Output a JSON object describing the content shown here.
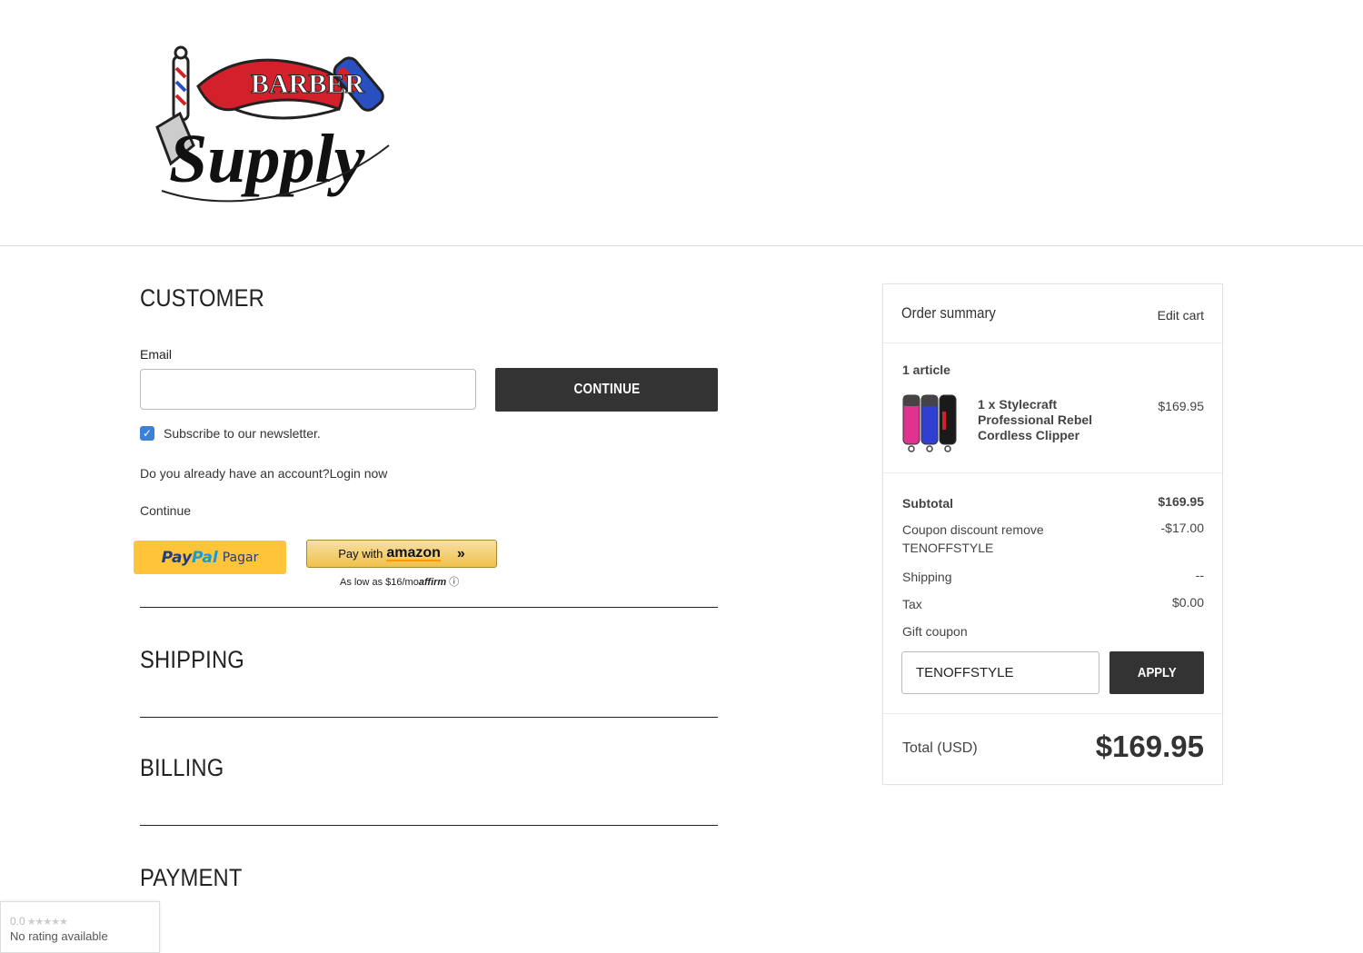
{
  "header": {
    "logo": {
      "top_text": "BARBER",
      "main_text": "Supply"
    }
  },
  "customer": {
    "title": "CUSTOMER",
    "email_label": "Email",
    "email_value": "",
    "continue_button": "CONTINUE",
    "newsletter_label": "Subscribe to our newsletter.",
    "newsletter_checked": true,
    "account_question": "Do you already have an account?Login now",
    "continue_link": "Continue"
  },
  "paypal": {
    "pay": "Pay",
    "pal": "Pal",
    "label": "Pagar",
    "color": "#ffc439"
  },
  "amazon": {
    "prefix": "Pay with",
    "brand": "amazon",
    "arrows": "»"
  },
  "affirm": {
    "text": "As low as $16/mo",
    "brand": "affirm",
    "info": "ⓘ"
  },
  "sections": {
    "shipping": "SHIPPING",
    "billing": "BILLING",
    "payment": "PAYMENT"
  },
  "order_summary": {
    "title": "Order summary",
    "edit_cart": "Edit cart",
    "article_count": "1 article",
    "item": {
      "name": "1 x Stylecraft Professional Rebel Cordless Clipper",
      "price": "$169.95",
      "colors": [
        "#e0338f",
        "#2f3fd1",
        "#1a1a1a"
      ]
    },
    "subtotal_label": "Subtotal",
    "subtotal_value": "$169.95",
    "coupon_label": "Coupon discount remove TENOFFSTYLE",
    "coupon_value": "-$17.00",
    "shipping_label": "Shipping",
    "shipping_value": "--",
    "tax_label": "Tax",
    "tax_value": "$0.00",
    "gift_label": "Gift coupon",
    "gift_value": "TENOFFSTYLE",
    "apply_button": "APPLY",
    "total_label": "Total (USD)",
    "total_value": "$169.95"
  },
  "rating": {
    "score": "0.0",
    "stars": "★★★★★",
    "text": "No rating available"
  },
  "colors": {
    "dark_button": "#333333",
    "checkbox": "#3b82d6"
  }
}
